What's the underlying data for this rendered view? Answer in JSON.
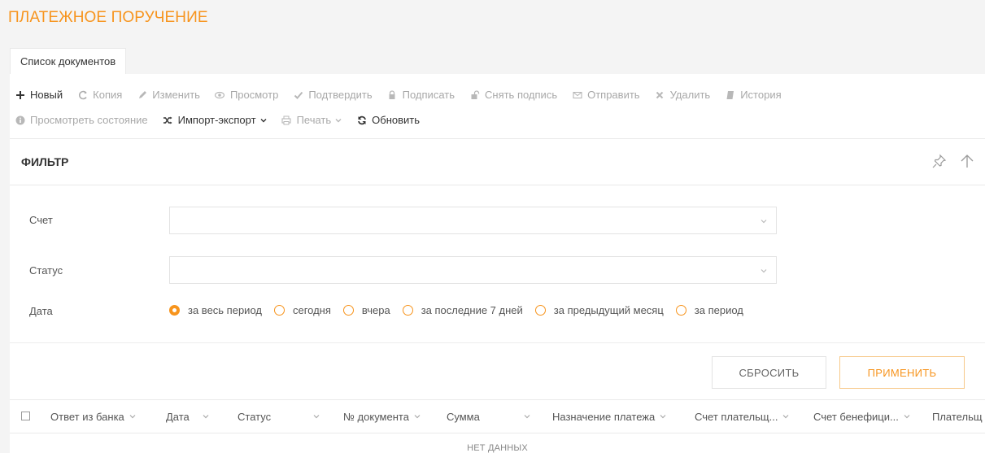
{
  "page": {
    "title": "ПЛАТЕЖНОЕ ПОРУЧЕНИЕ"
  },
  "tabs": [
    {
      "label": "Список документов"
    }
  ],
  "toolbar": {
    "row1": [
      {
        "label": "Новый",
        "icon": "plus-icon",
        "active": true
      },
      {
        "label": "Копия",
        "icon": "copy-icon"
      },
      {
        "label": "Изменить",
        "icon": "pencil-icon"
      },
      {
        "label": "Просмотр",
        "icon": "eye-icon"
      },
      {
        "label": "Подтвердить",
        "icon": "check-icon"
      },
      {
        "label": "Подписать",
        "icon": "lock-icon"
      },
      {
        "label": "Снять подпись",
        "icon": "unlock-icon"
      },
      {
        "label": "Отправить",
        "icon": "envelope-icon"
      },
      {
        "label": "Удалить",
        "icon": "cross-icon"
      },
      {
        "label": "История",
        "icon": "book-icon"
      }
    ],
    "row2": [
      {
        "label": "Просмотреть состояние",
        "icon": "info-icon"
      },
      {
        "label": "Импорт-экспорт",
        "icon": "shuffle-icon",
        "active": true
      },
      {
        "label": "Печать",
        "icon": "printer-icon"
      },
      {
        "label": "Обновить",
        "icon": "refresh-icon",
        "active": true
      }
    ]
  },
  "filter": {
    "title": "ФИЛЬТР",
    "account_label": "Счет",
    "account_value": "",
    "status_label": "Статус",
    "status_value": "",
    "date_label": "Дата",
    "date_options": [
      "за весь период",
      "сегодня",
      "вчера",
      "за последние 7 дней",
      "за предыдущий месяц",
      "за период"
    ],
    "date_selected": "за весь период",
    "reset_label": "СБРОСИТЬ",
    "apply_label": "ПРИМЕНИТЬ"
  },
  "table": {
    "columns": [
      "Ответ из банка",
      "Дата",
      "Статус",
      "№ документа",
      "Сумма",
      "Назначение платежа",
      "Счет плательщ...",
      "Счет бенефици...",
      "Плательщ"
    ],
    "empty_text": "НЕТ ДАННЫХ"
  },
  "colors": {
    "accent": "#f7941d",
    "muted": "#a8a8a8",
    "border": "#e3e3e3"
  }
}
